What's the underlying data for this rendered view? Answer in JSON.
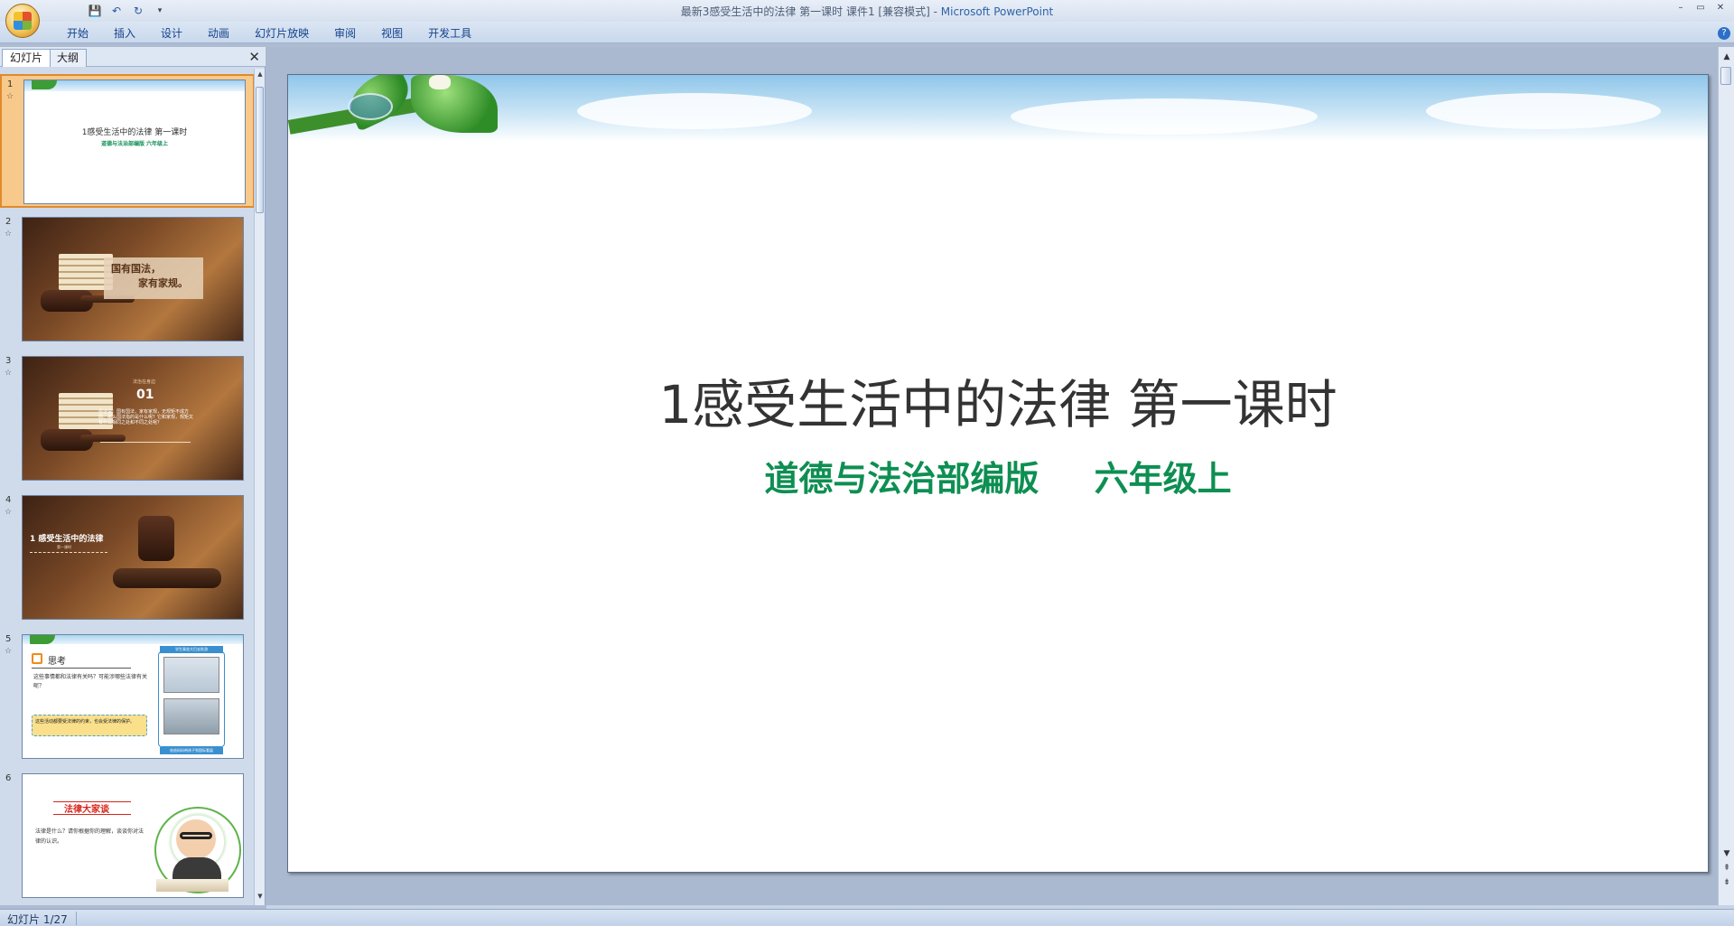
{
  "window": {
    "title": "最新3感受生活中的法律  第一课时 课件1 [兼容模式]",
    "app_name": "Microsoft PowerPoint",
    "controls": [
      "–",
      "▭",
      "✕"
    ]
  },
  "quick_access": {
    "icons": [
      "save-icon",
      "undo-icon",
      "redo-icon",
      "customize-qat-icon"
    ],
    "glyphs": [
      "💾",
      "↶",
      "↻",
      "▾"
    ]
  },
  "ribbon": {
    "tabs": [
      "开始",
      "插入",
      "设计",
      "动画",
      "幻灯片放映",
      "审阅",
      "视图",
      "开发工具"
    ],
    "help": "?"
  },
  "left_pane": {
    "tabs": [
      "幻灯片",
      "大纲"
    ],
    "close": "✕",
    "thumbnails": [
      {
        "num": "1",
        "title": "1感受生活中的法律  第一课时",
        "subtitle": "道德与法治部编版     六年级上"
      },
      {
        "num": "2",
        "line1": "国有国法，",
        "line2": "家有家规。"
      },
      {
        "num": "3",
        "number": "01",
        "small": "法治在身边",
        "text": "俗话说：国有国法，家有家规，无规矩不成方圆。那么国法指的是什么呢？它和家规，规矩又有什么相同之处和不同之处呢？"
      },
      {
        "num": "4",
        "title": "1 感受生活中的法律",
        "subtitle": "第一课时"
      },
      {
        "num": "5",
        "title": "思考",
        "question": "这些事情都和法律有关吗？可能涉哪些法律有关呢？",
        "note": "这些活动都要受法律的约束，也会受法律的保护。",
        "cap1": "学生乘坐大巴去秋游",
        "cap2": "爸爸妈妈带孩子到国际看展"
      },
      {
        "num": "6",
        "title": "法律大家谈",
        "text": "法律是什么？请你根据你的理解，谈谈你对法律的认识。"
      }
    ],
    "star": "☆"
  },
  "slide": {
    "title": "1感受生活中的法律  第一课时",
    "subtitle_left": "道德与法治部编版",
    "subtitle_right": "六年级上",
    "colors": {
      "title": "#333333",
      "subtitle": "#0e8f52"
    }
  },
  "scroll": {
    "up": "▲",
    "down": "▼",
    "prev_slide": "⇞",
    "next_slide": "⇟"
  },
  "status": {
    "slide_counter": "幻灯片 1/27"
  }
}
